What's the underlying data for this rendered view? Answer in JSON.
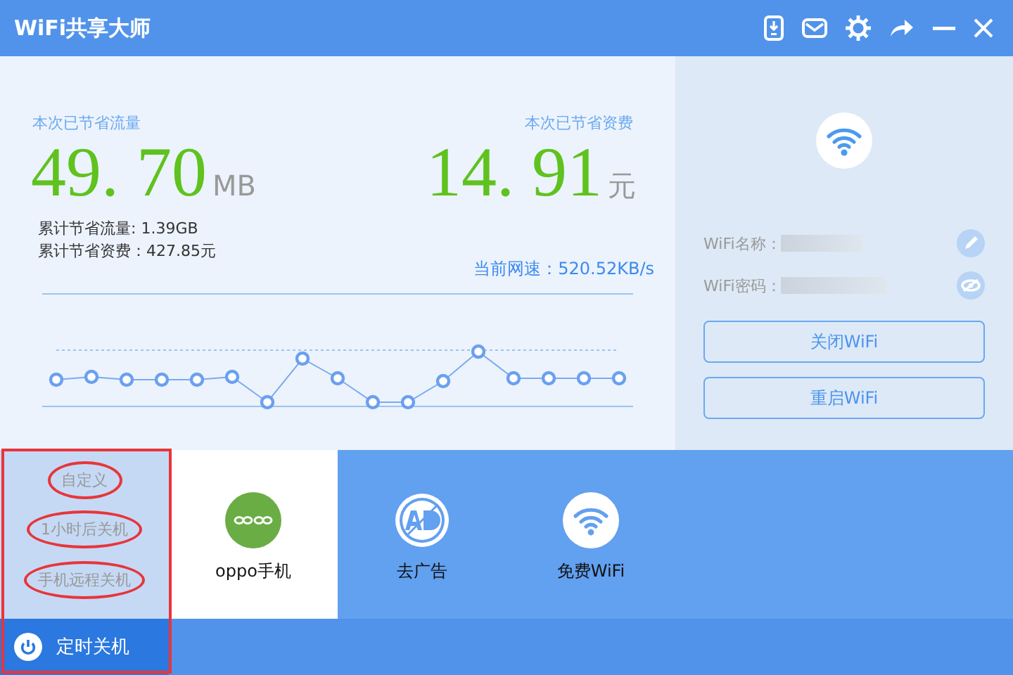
{
  "window": {
    "title": "WiFi共享大师"
  },
  "toolbar": [
    {
      "kind": "phone-download"
    },
    {
      "kind": "mail"
    },
    {
      "kind": "settings"
    },
    {
      "kind": "share"
    },
    {
      "kind": "minimize"
    },
    {
      "kind": "close"
    }
  ],
  "savings": {
    "traffic_label": "本次已节省流量",
    "traffic_value": "49. 70",
    "traffic_unit": "MB",
    "cost_label": "本次已节省资费",
    "cost_value": "14. 91",
    "cost_unit": "元",
    "total_traffic": "累计节省流量: 1.39GB",
    "total_cost": "累计节省资费：427.85元",
    "speed": "当前网速：520.52KB/s"
  },
  "wifi": {
    "name_label": "WiFi名称：",
    "password_label": "WiFi密码：",
    "buttons": [
      "关闭WiFi",
      "重启WiFi"
    ]
  },
  "timer_menu": {
    "outlined": true,
    "items": [
      {
        "label": "自定义",
        "circled": true
      },
      {
        "label": "1小时后关机",
        "circled": true
      },
      {
        "label": "手机远程关机",
        "circled": true
      }
    ],
    "button": "定时关机"
  },
  "tiles": [
    {
      "kind": "oppo",
      "label": "oppo手机"
    },
    {
      "kind": "no-ad",
      "label": "去广告"
    },
    {
      "kind": "wifi",
      "label": "免费WiFi"
    }
  ]
}
